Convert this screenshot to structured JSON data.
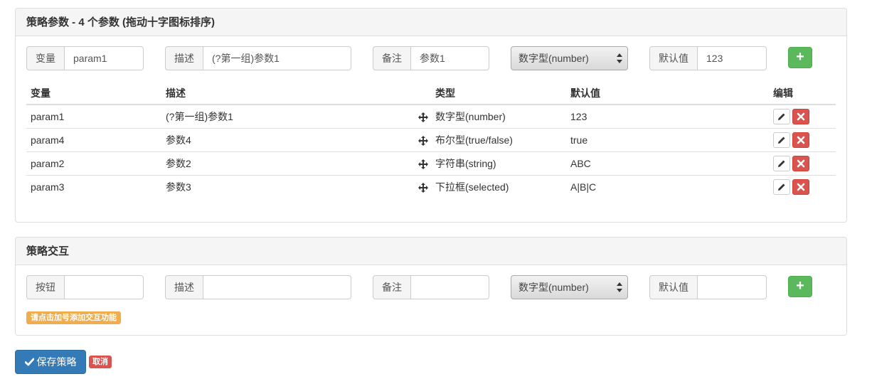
{
  "params_panel": {
    "title": "策略参数 - 4 个参数 (拖动十字图标排序)",
    "form": {
      "var_label": "变量",
      "var_value": "param1",
      "desc_label": "描述",
      "desc_value": "(?第一组)参数1",
      "note_label": "备注",
      "note_value": "参数1",
      "type_selected": "数字型(number)",
      "default_label": "默认值",
      "default_value": "123",
      "add_icon": "plus-icon"
    },
    "table": {
      "headers": {
        "var": "变量",
        "desc": "描述",
        "type": "类型",
        "default": "默认值",
        "edit": "编辑"
      },
      "rows": [
        {
          "var": "param1",
          "desc": "(?第一组)参数1",
          "type": "数字型(number)",
          "default": "123"
        },
        {
          "var": "param4",
          "desc": "参数4",
          "type": "布尔型(true/false)",
          "default": "true"
        },
        {
          "var": "param2",
          "desc": "参数2",
          "type": "字符串(string)",
          "default": "ABC"
        },
        {
          "var": "param3",
          "desc": "参数3",
          "type": "下拉框(selected)",
          "default": "A|B|C"
        }
      ]
    }
  },
  "interaction_panel": {
    "title": "策略交互",
    "form": {
      "button_label": "按钮",
      "button_value": "",
      "desc_label": "描述",
      "desc_value": "",
      "note_label": "备注",
      "note_value": "",
      "type_selected": "数字型(number)",
      "default_label": "默认值",
      "default_value": "",
      "add_icon": "plus-icon"
    },
    "hint": "请点击加号添加交互功能"
  },
  "footer": {
    "save_label": "保存策略",
    "cancel_label": "取消"
  },
  "colors": {
    "success": "#5cb85c",
    "primary": "#337ab7",
    "danger": "#d9534f",
    "warning": "#f0ad4e"
  }
}
